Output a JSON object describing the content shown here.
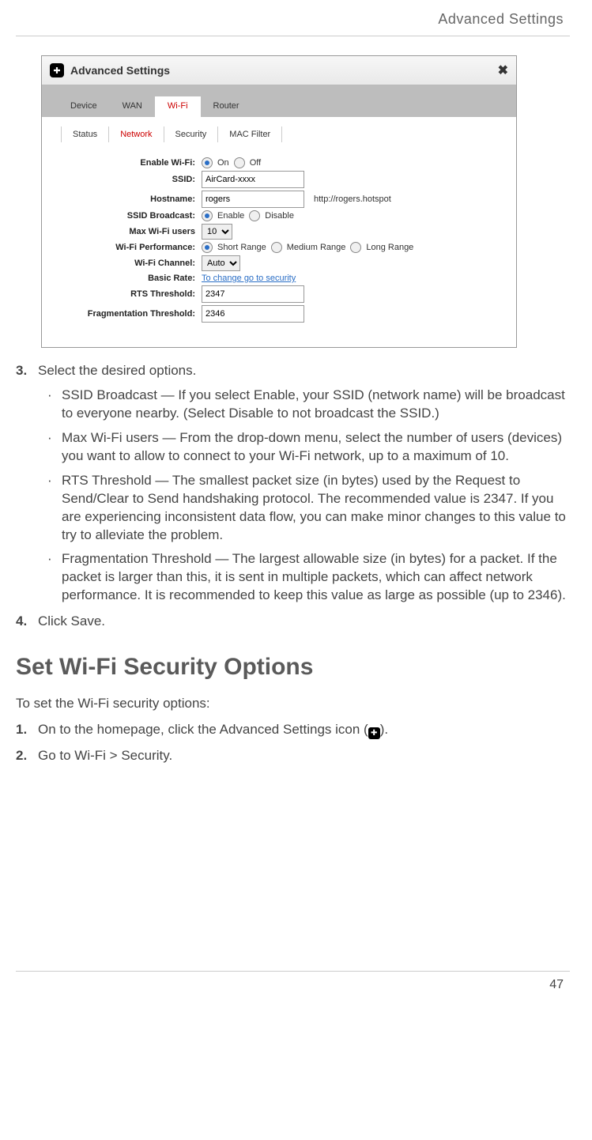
{
  "header": {
    "title": "Advanced Settings"
  },
  "dialog": {
    "title": "Advanced Settings",
    "primary_tabs": {
      "t0": "Device",
      "t1": "WAN",
      "t2": "Wi-Fi",
      "t3": "Router"
    },
    "sub_tabs": {
      "s0": "Status",
      "s1": "Network",
      "s2": "Security",
      "s3": "MAC Filter"
    },
    "form": {
      "enable_wifi_label": "Enable Wi-Fi:",
      "on": "On",
      "off": "Off",
      "ssid_label": "SSID:",
      "ssid_value": "AirCard-xxxx",
      "hostname_label": "Hostname:",
      "hostname_value": "rogers",
      "hostname_suffix": "http://rogers.hotspot",
      "ssid_broadcast_label": "SSID Broadcast:",
      "enable": "Enable",
      "disable": "Disable",
      "max_users_label": "Max Wi-Fi users",
      "max_users_value": "10",
      "perf_label": "Wi-Fi Performance:",
      "perf_short": "Short Range",
      "perf_medium": "Medium Range",
      "perf_long": "Long Range",
      "channel_label": "Wi-Fi Channel:",
      "channel_value": "Auto",
      "basic_rate_label": "Basic Rate:",
      "basic_rate_link": "To change go to security",
      "rts_label": "RTS Threshold:",
      "rts_value": "2347",
      "frag_label": "Fragmentation Threshold:",
      "frag_value": "2346"
    }
  },
  "step3": {
    "num": "3.",
    "text": "Select the desired options.",
    "bullets": {
      "b0": "SSID Broadcast — If you select Enable, your SSID (network name) will be broadcast to everyone nearby. (Select Disable to not broadcast the SSID.)",
      "b1": "Max Wi-Fi users — From the drop-down menu, select the number of users (devices) you want to allow to connect to your Wi-Fi network, up to a maximum of 10.",
      "b2": "RTS Threshold — The smallest packet size (in bytes) used by the Request to Send/Clear to Send handshaking protocol. The recommended value is 2347. If you are experiencing inconsistent data flow, you can make minor changes to this value to try to alleviate the problem.",
      "b3": "Fragmentation Threshold — The largest allowable size (in bytes) for a packet. If the packet is larger than this, it is sent in multiple packets, which can affect network performance. It is recommended to keep this value as large as possible (up to 2346)."
    }
  },
  "step4": {
    "num": "4.",
    "text": "Click Save."
  },
  "section_heading": "Set Wi-Fi Security Options",
  "intro2": "To set the Wi-Fi security options:",
  "sec_step1": {
    "num": "1.",
    "pre": "On to the homepage, click the Advanced Settings icon (",
    "post": ")."
  },
  "sec_step2": {
    "num": "2.",
    "text": "Go to Wi-Fi > Security."
  },
  "page_number": "47"
}
